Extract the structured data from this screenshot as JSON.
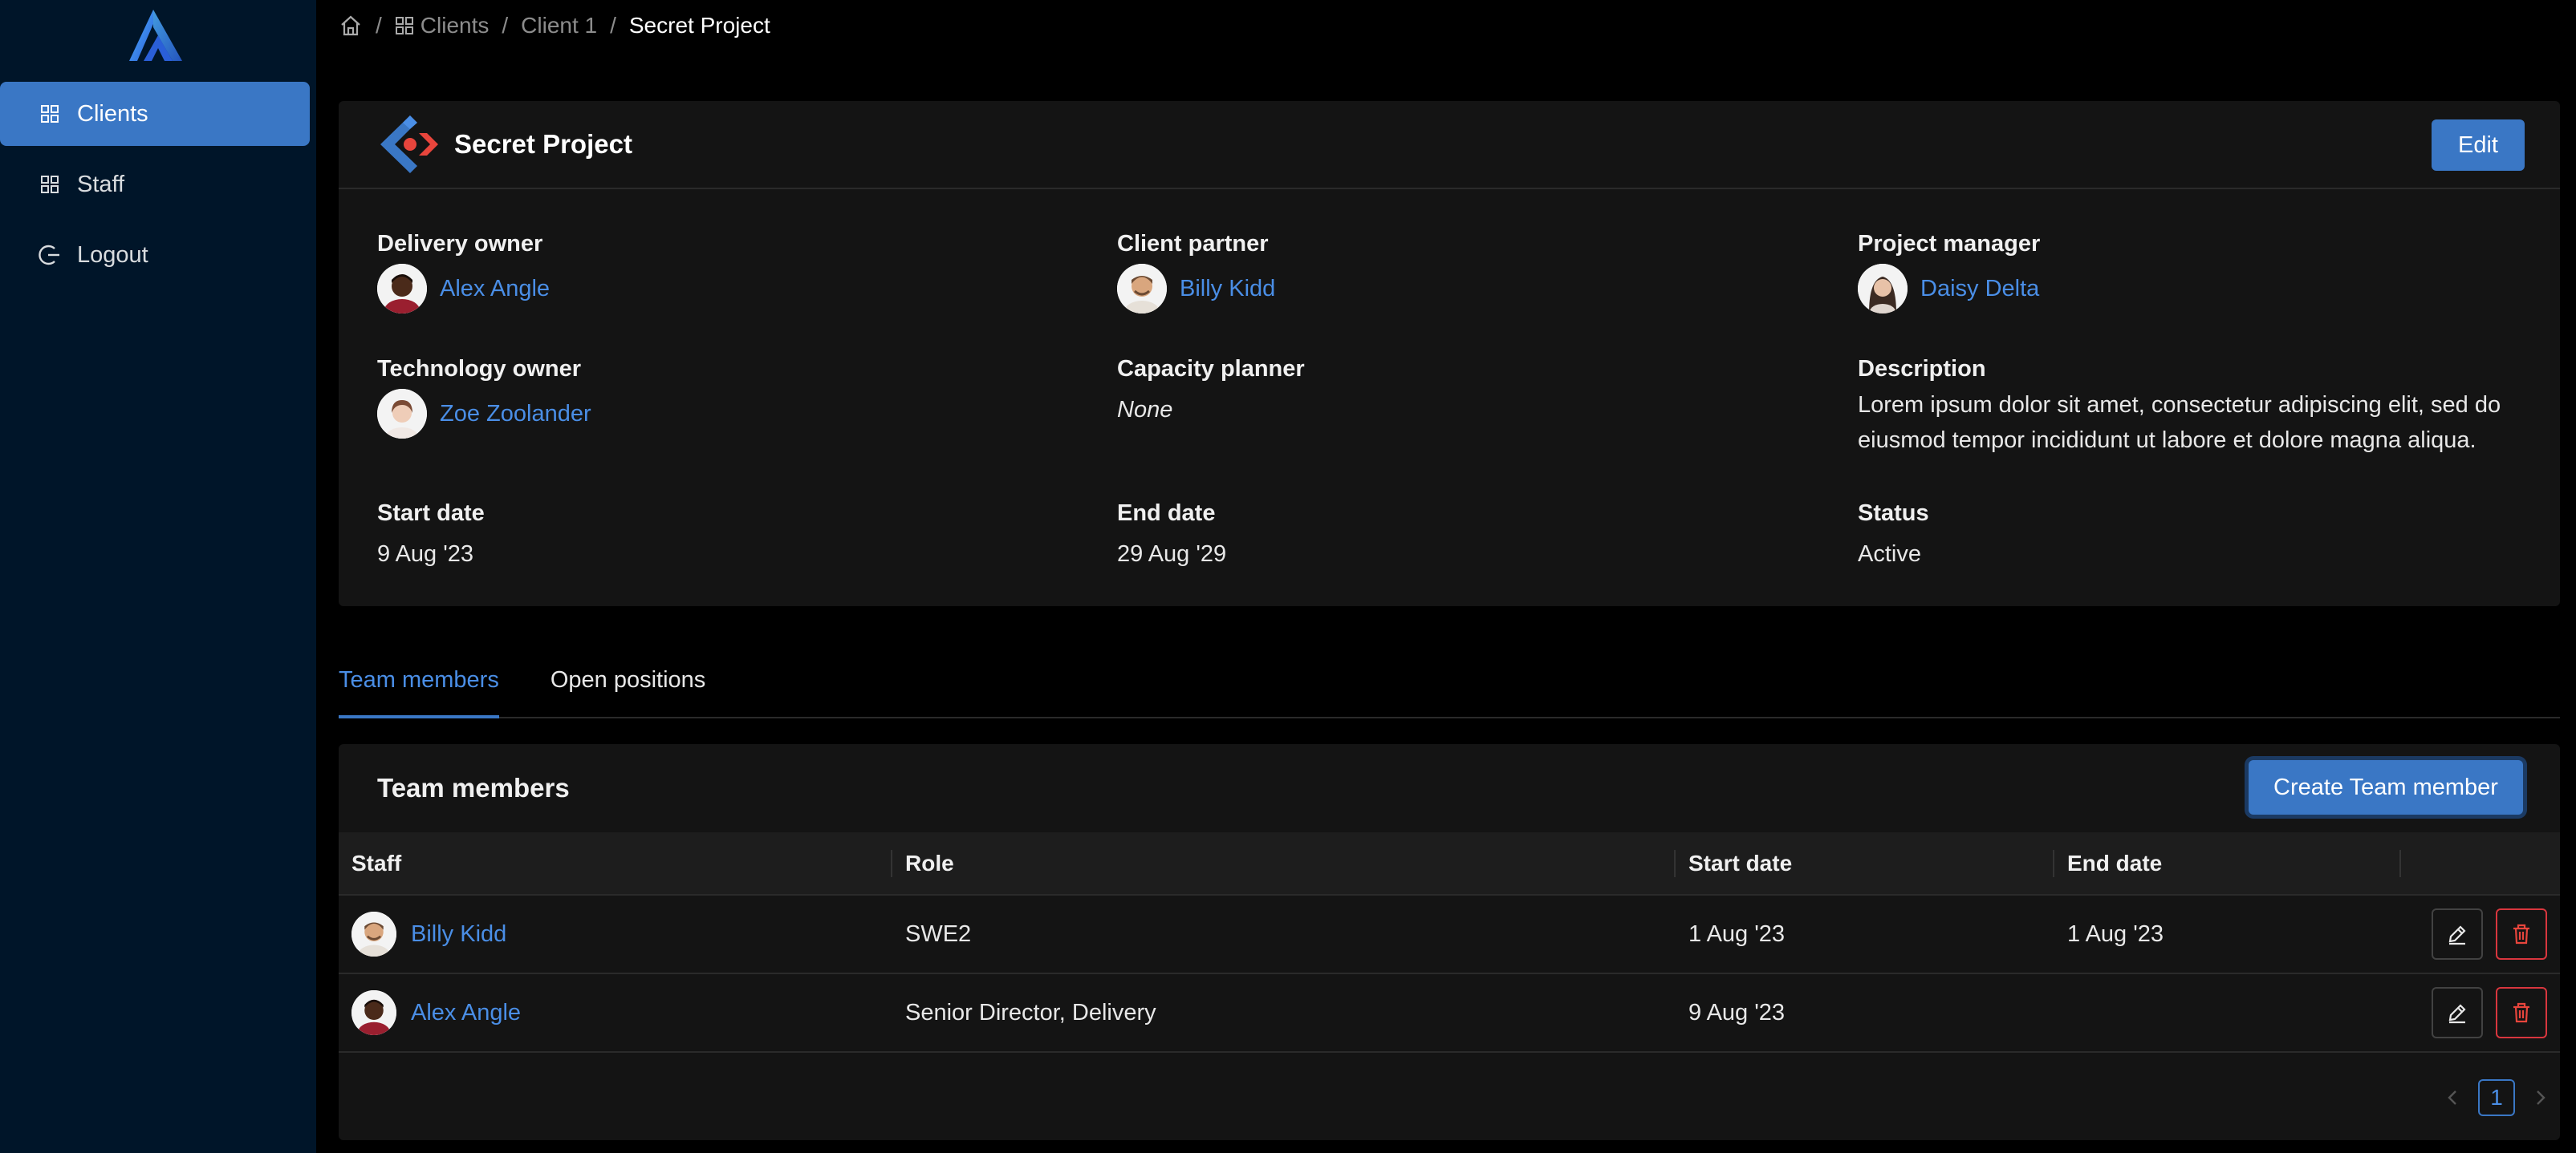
{
  "sidebar": {
    "items": [
      {
        "label": "Clients",
        "icon": "grid-icon",
        "active": true
      },
      {
        "label": "Staff",
        "icon": "grid-icon",
        "active": false
      },
      {
        "label": "Logout",
        "icon": "logout-icon",
        "active": false
      }
    ]
  },
  "breadcrumb": {
    "items": [
      "Clients",
      "Client 1",
      "Secret Project"
    ],
    "separator": "/"
  },
  "project": {
    "title": "Secret Project",
    "edit_label": "Edit",
    "fields": {
      "delivery_owner": {
        "label": "Delivery owner",
        "value": "Alex Angle"
      },
      "client_partner": {
        "label": "Client partner",
        "value": "Billy Kidd"
      },
      "project_manager": {
        "label": "Project manager",
        "value": "Daisy Delta"
      },
      "technology_owner": {
        "label": "Technology owner",
        "value": "Zoe Zoolander"
      },
      "capacity_planner": {
        "label": "Capacity planner",
        "value": "None"
      },
      "description": {
        "label": "Description",
        "value": "Lorem ipsum dolor sit amet, consectetur adipiscing elit, sed do eiusmod tempor incididunt ut labore et dolore magna aliqua."
      },
      "start_date": {
        "label": "Start date",
        "value": "9 Aug '23"
      },
      "end_date": {
        "label": "End date",
        "value": "29 Aug '29"
      },
      "status": {
        "label": "Status",
        "value": "Active"
      }
    }
  },
  "tabs": [
    {
      "label": "Team members",
      "active": true
    },
    {
      "label": "Open positions",
      "active": false
    }
  ],
  "team": {
    "title": "Team members",
    "create_label": "Create Team member",
    "columns": [
      "Staff",
      "Role",
      "Start date",
      "End date"
    ],
    "rows": [
      {
        "staff": "Billy Kidd",
        "role": "SWE2",
        "start": "1 Aug '23",
        "end": "1 Aug '23"
      },
      {
        "staff": "Alex Angle",
        "role": "Senior Director, Delivery",
        "start": "9 Aug '23",
        "end": ""
      }
    ],
    "pagination": {
      "current": "1"
    }
  },
  "colors": {
    "accent": "#3a77c5",
    "link": "#4a8ee6",
    "sidebar_bg": "#001529",
    "card_bg": "#141414",
    "danger": "#d9363e"
  }
}
